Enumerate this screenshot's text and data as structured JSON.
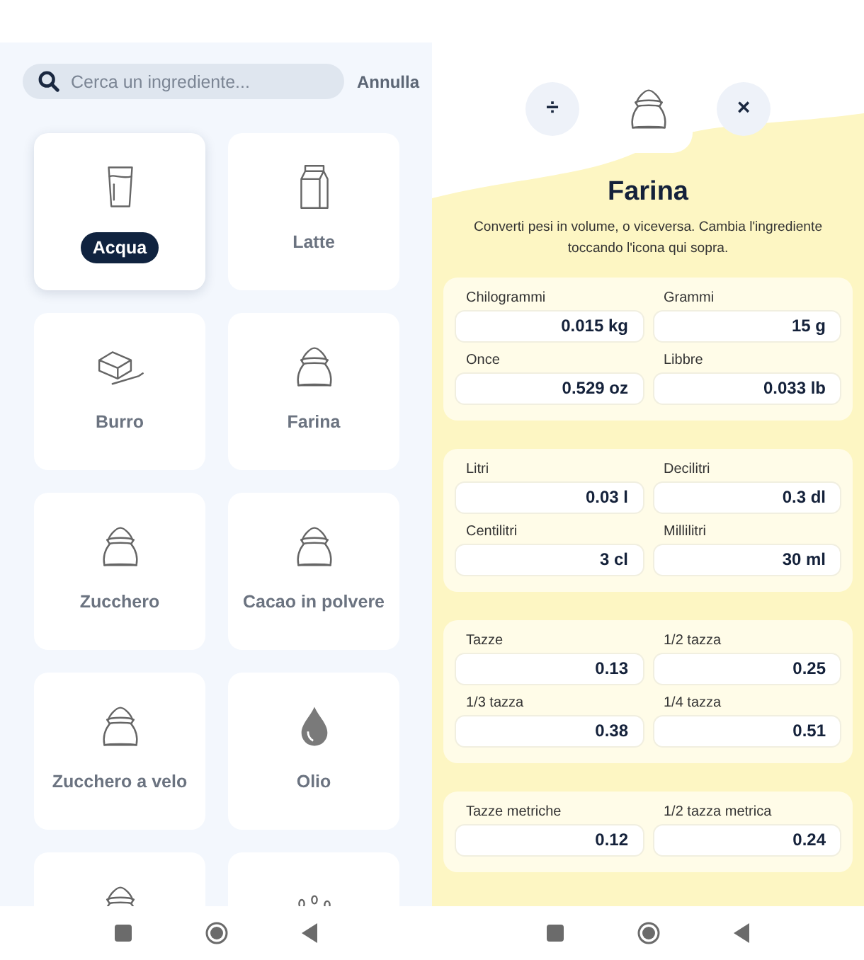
{
  "search": {
    "placeholder": "Cerca un ingrediente...",
    "cancel": "Annulla"
  },
  "ingredients": [
    {
      "label": "Acqua",
      "kind": "glass",
      "selected": true
    },
    {
      "label": "Latte",
      "kind": "carton",
      "selected": false
    },
    {
      "label": "Burro",
      "kind": "butter",
      "selected": false
    },
    {
      "label": "Farina",
      "kind": "sack",
      "selected": false
    },
    {
      "label": "Zucchero",
      "kind": "sack",
      "selected": false
    },
    {
      "label": "Cacao in polvere",
      "kind": "sack",
      "selected": false
    },
    {
      "label": "Zucchero a velo",
      "kind": "sack",
      "selected": false
    },
    {
      "label": "Olio",
      "kind": "drop",
      "selected": false
    },
    {
      "kind": "sack",
      "selected": false
    },
    {
      "kind": "beans",
      "selected": false
    }
  ],
  "converter": {
    "divide_button": "÷",
    "close_button": "×",
    "ingredient_button": {
      "kind": "sack"
    },
    "title": "Farina",
    "description": "Converti pesi in volume, o viceversa. Cambia l'ingrediente toccando l'icona qui sopra.",
    "groups": [
      {
        "fields": [
          {
            "label": "Chilogrammi",
            "value": "0.015 kg"
          },
          {
            "label": "Grammi",
            "value": "15 g"
          },
          {
            "label": "Once",
            "value": "0.529 oz"
          },
          {
            "label": "Libbre",
            "value": "0.033 lb"
          }
        ]
      },
      {
        "fields": [
          {
            "label": "Litri",
            "value": "0.03 l"
          },
          {
            "label": "Decilitri",
            "value": "0.3 dl"
          },
          {
            "label": "Centilitri",
            "value": "3 cl"
          },
          {
            "label": "Millilitri",
            "value": "30 ml"
          }
        ]
      },
      {
        "fields": [
          {
            "label": "Tazze",
            "value": "0.13"
          },
          {
            "label": "1/2 tazza",
            "value": "0.25"
          },
          {
            "label": "1/3 tazza",
            "value": "0.38"
          },
          {
            "label": "1/4 tazza",
            "value": "0.51"
          }
        ]
      },
      {
        "fields": [
          {
            "label": "Tazze metriche",
            "value": "0.12"
          },
          {
            "label": "1/2 tazza metrica",
            "value": "0.24"
          }
        ]
      }
    ]
  }
}
